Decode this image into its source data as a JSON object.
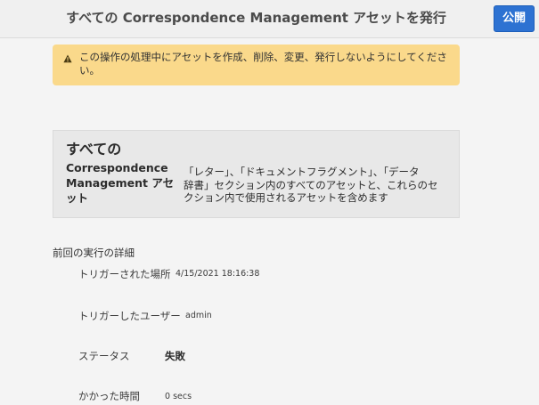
{
  "header": {
    "title": "すべての Correspondence Management アセットを発行",
    "publish_label": "公開"
  },
  "alert": {
    "icon": "warning-icon",
    "line1": "この操作の処理中にアセットを作成、削除、変更、発行しないようにしてくださ",
    "line2": "い。"
  },
  "card": {
    "title_line1": "すべての",
    "title_line2": "Correspondence",
    "title_line3": "Management アセ",
    "title_line4": "ット",
    "desc_line1": "「レター」、「ドキュメントフラグメント」、「データ",
    "desc_line2": "辞書」セクション内のすべてのアセットと、これらのセ",
    "desc_line3": "クション内で使用されるアセットを含めます"
  },
  "details": {
    "section_title": "前回の実行の詳細",
    "rows": [
      {
        "label": "トリガーされた場所",
        "value": "4/15/2021 18:16:38"
      },
      {
        "label": "トリガーしたユーザー",
        "value": "admin"
      },
      {
        "label": "ステータス",
        "value": "失敗"
      },
      {
        "label": "かかった時間",
        "value": "0 secs"
      }
    ]
  },
  "colors": {
    "primary_button": "#2d72d2",
    "alert_background": "#fad98b",
    "page_background": "#f4f4f4",
    "card_background": "#e8e8e8"
  }
}
